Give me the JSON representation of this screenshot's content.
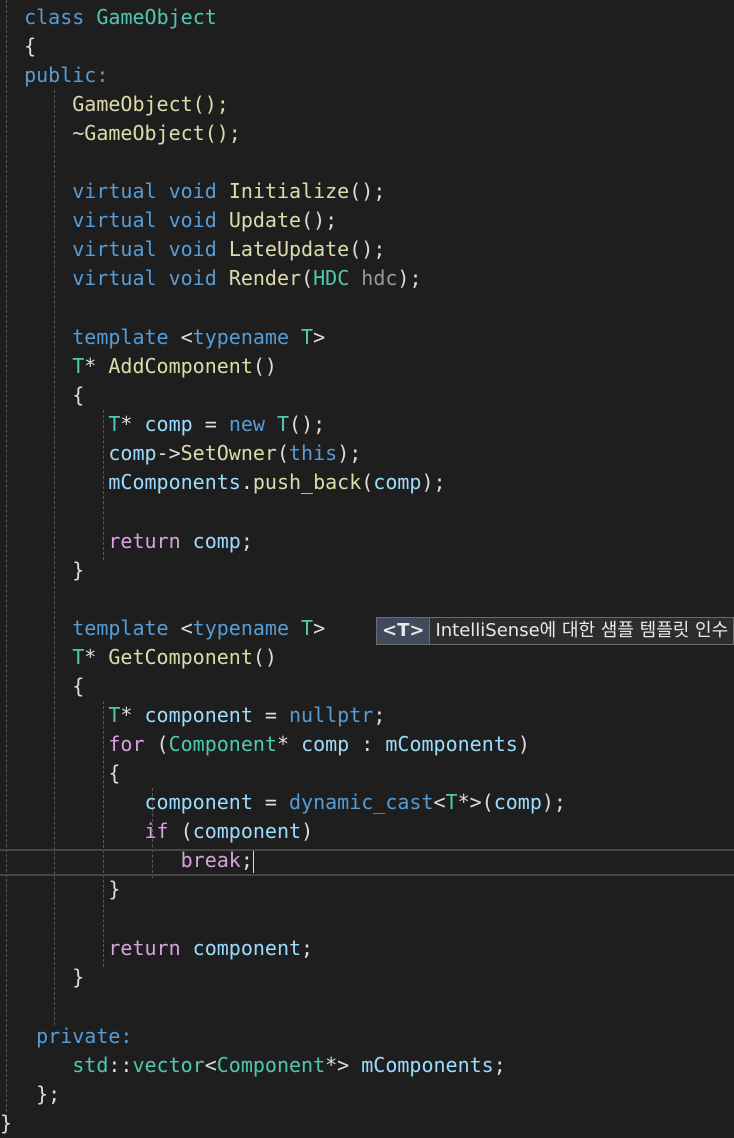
{
  "code": {
    "class_line": [
      "class",
      "GameObject"
    ],
    "open_brace": "{",
    "public_label": "public:",
    "ctor": "GameObject();",
    "dtor": "~GameObject();",
    "methods": [
      {
        "kw1": "virtual",
        "kw2": "void",
        "name": "Initialize",
        "rest": "();"
      },
      {
        "kw1": "virtual",
        "kw2": "void",
        "name": "Update",
        "rest": "();"
      },
      {
        "kw1": "virtual",
        "kw2": "void",
        "name": "LateUpdate",
        "rest": "();"
      },
      {
        "kw1": "virtual",
        "kw2": "void",
        "name": "Render",
        "param_type": "HDC",
        "param_name": "hdc",
        "rest": ");"
      }
    ],
    "template_kw": "template",
    "typename_kw": "typename",
    "T": "T",
    "add_component": "AddComponent",
    "get_component": "GetComponent",
    "new_kw": "new",
    "comp": "comp",
    "set_owner": "SetOwner",
    "this_kw": "this",
    "m_components": "mComponents",
    "push_back": "push_back",
    "return_kw": "return",
    "component": "component",
    "nullptr_kw": "nullptr",
    "for_kw": "for",
    "component_type": "Component",
    "dynamic_cast": "dynamic_cast",
    "if_kw": "if",
    "break_kw": "break",
    "private_label": "private:",
    "std": "std",
    "vector": "vector",
    "close_class": "};",
    "last_brace": "}"
  },
  "intellisense_hint": {
    "tag": "<T>",
    "message": "IntelliSense에 대한 샘플 템플릿 인수 제공"
  },
  "colors": {
    "background": "#1e1e1e",
    "keyword": "#569cd6",
    "control": "#d8a0df",
    "type": "#4ec9b0",
    "function": "#dcdcaa",
    "variable": "#9cdcfe",
    "text": "#dcdcdc"
  }
}
